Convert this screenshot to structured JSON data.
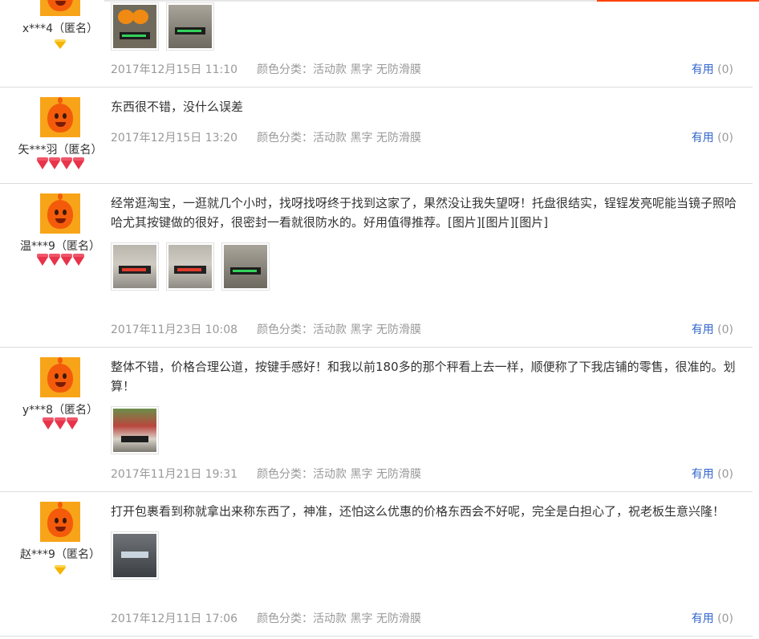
{
  "useful_label": "有用",
  "reviews": [
    {
      "user": "x***4（匿名）",
      "level": {
        "type": "gold",
        "count": 1
      },
      "text": "",
      "pics": [
        "orange",
        "scale2"
      ],
      "date": "2017年12月15日 11:10",
      "sku": "颜色分类：活动款 黑字 无防滑膜",
      "useful_count": "(0)"
    },
    {
      "user": "矢***羽（匿名）",
      "level": {
        "type": "red",
        "count": 4
      },
      "text": "东西很不错，没什么误差",
      "pics": [],
      "date": "2017年12月15日 13:20",
      "sku": "颜色分类：活动款 黑字 无防滑膜",
      "useful_count": "(0)"
    },
    {
      "user": "温***9（匿名）",
      "level": {
        "type": "red",
        "count": 4
      },
      "text": "经常逛淘宝，一逛就几个小时，找呀找呀终于找到这家了，果然没让我失望呀！托盘很结实，锃锃发亮呢能当镜子照哈哈尤其按键做的很好，很密封一看就很防水的。好用值得推荐。[图片][图片][图片]",
      "pics": [
        "scale",
        "scale",
        "scale"
      ],
      "date": "2017年11月23日 10:08",
      "sku": "颜色分类：活动款 黑字 无防滑膜",
      "useful_count": "(0)"
    },
    {
      "user": "y***8（匿名）",
      "level": {
        "type": "red",
        "count": 3
      },
      "text": "整体不错，价格合理公道，按键手感好！和我以前180多的那个秤看上去一样，顺便称了下我店铺的零售，很准的。划算！",
      "pics": [
        "flowers"
      ],
      "date": "2017年11月21日 19:31",
      "sku": "颜色分类：活动款 黑字 无防滑膜",
      "useful_count": "(0)"
    },
    {
      "user": "赵***9（匿名）",
      "level": {
        "type": "gold",
        "count": 1
      },
      "text": "打开包裹看到称就拿出来称东西了，神准，还怕这么优惠的价格东西会不好呢，完全是白担心了，祝老板生意兴隆！",
      "pics": [
        "dark"
      ],
      "date": "2017年12月11日 17:06",
      "sku": "颜色分类：活动款 黑字 无防滑膜",
      "useful_count": "(0)"
    }
  ]
}
